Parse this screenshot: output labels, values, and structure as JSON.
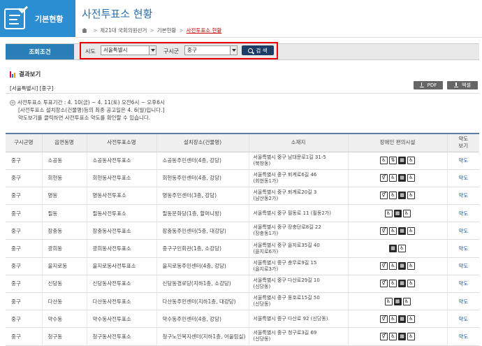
{
  "sidebar": {
    "title": "기본현황",
    "icon": "document-check-icon"
  },
  "page": {
    "title": "사전투표소 현황"
  },
  "breadcrumb": {
    "items": [
      "제21대 국회의원선거",
      "기본현황",
      "사전투표소 현황"
    ]
  },
  "search": {
    "section_label": "조회조건",
    "sido_label": "시도",
    "sido_value": "서울특별시",
    "gu_label": "구시군",
    "gu_value": "중구",
    "button_label": "검 색"
  },
  "results": {
    "title": "결과보기",
    "region": "[서울특별시] [중구]",
    "pdf_label": "PDF",
    "excel_label": "엑셀"
  },
  "notice": {
    "line1": "사전투표소 투표기간 : 4. 10(금) ~ 4. 11(토) 오전6시 ~ 오후6시",
    "line2": "[사전투표소 설치장소(건물명)등의 최종 공고일은 4. 6(월)입니다.]",
    "line3": "약도보기를 클릭하면 사전투표소 약도를 확인할 수 있습니다."
  },
  "table": {
    "headers": [
      "구시군명",
      "읍면동명",
      "사전투표소명",
      "설치장소(건물명)",
      "소재지",
      "장애인 편의시설",
      "약도\n보기"
    ],
    "rows": [
      {
        "gu": "중구",
        "dong": "소공동",
        "name": "소공동사전투표소",
        "place": "소공동주민센터(4층, 강당)",
        "addr1": "서울특별시 중구 남대문로1길 31-5",
        "addr2": "(북창동)",
        "facilities": [
          "wheelchair",
          "elevator",
          "parking",
          "ramp"
        ],
        "map": "약도"
      },
      {
        "gu": "중구",
        "dong": "회현동",
        "name": "회현동사전투표소",
        "place": "회현동주민센터(4층, 강당)",
        "addr1": "서울특별시 중구 퇴계로6길 46",
        "addr2": "(회현동1가)",
        "facilities": [
          "toilet",
          "wheelchair",
          "parking",
          "ramp"
        ],
        "map": "약도"
      },
      {
        "gu": "중구",
        "dong": "명동",
        "name": "명동사전투표소",
        "place": "명동주민센터(3층, 강당)",
        "addr1": "서울특별시 중구 퇴계로20길 3",
        "addr2": "(남산동2가)",
        "facilities": [
          "toilet",
          "wheelchair",
          "parking",
          "ramp"
        ],
        "map": "약도"
      },
      {
        "gu": "중구",
        "dong": "필동",
        "name": "필동사전투표소",
        "place": "필동문화당(1층, 할머니방)",
        "addr1": "서울특별시 중구 필동로 11 (필동2가)",
        "addr2": "",
        "facilities": [
          "wheelchair",
          "parking",
          "ramp"
        ],
        "map": "약도"
      },
      {
        "gu": "중구",
        "dong": "장충동",
        "name": "장충동사전투표소",
        "place": "장충동주민센터(5층, 대강당)",
        "addr1": "서울특별시 중구 장충단로8길 22",
        "addr2": "(장충동1가)",
        "facilities": [
          "toilet",
          "wheelchair",
          "parking",
          "ramp"
        ],
        "map": "약도"
      },
      {
        "gu": "중구",
        "dong": "광희동",
        "name": "광희동사전투표소",
        "place": "중구구민회관(1층, 소강당)",
        "addr1": "서울특별시 중구 을지로35길 40",
        "addr2": "(을지로6가)",
        "facilities": [
          "parking",
          "ramp"
        ],
        "map": "약도"
      },
      {
        "gu": "중구",
        "dong": "을지로동",
        "name": "을지로동사전투표소",
        "place": "을지로동주민센터(4층, 강당)",
        "addr1": "서울특별시 중구 충무로9길 15",
        "addr2": "(을지로3가)",
        "facilities": [
          "toilet",
          "wheelchair",
          "parking",
          "ramp"
        ],
        "map": "약도"
      },
      {
        "gu": "중구",
        "dong": "신당동",
        "name": "신당동사전투표소",
        "place": "신당동경로당(지하1층, 소강당)",
        "addr1": "서울특별시 중구 다산로29길 10",
        "addr2": "(신당동)",
        "facilities": [
          "toilet",
          "wheelchair",
          "parking",
          "ramp"
        ],
        "map": "약도"
      },
      {
        "gu": "중구",
        "dong": "다산동",
        "name": "다산동사전투표소",
        "place": "다산동주민센터(지하1층, 대강당)",
        "addr1": "서울특별시 중구 동호로15길 50",
        "addr2": "(신당동)",
        "facilities": [
          "wheelchair",
          "parking",
          "ramp"
        ],
        "map": "약도"
      },
      {
        "gu": "중구",
        "dong": "약수동",
        "name": "약수동사전투표소",
        "place": "약수동주민센터(4층, 강당)",
        "addr1": "서울특별시 중구 다산로 92 (신당동)",
        "addr2": "",
        "facilities": [
          "toilet",
          "wheelchair",
          "parking",
          "ramp"
        ],
        "map": "약도"
      },
      {
        "gu": "중구",
        "dong": "청구동",
        "name": "청구동사전투표소",
        "place": "청구노인복지센터(지하1층, 어울림실)",
        "addr1": "서울특별시 중구 청구로3길 69",
        "addr2": "(신당동)",
        "facilities": [
          "toilet",
          "wheelchair",
          "parking",
          "ramp"
        ],
        "map": "약도"
      }
    ]
  }
}
